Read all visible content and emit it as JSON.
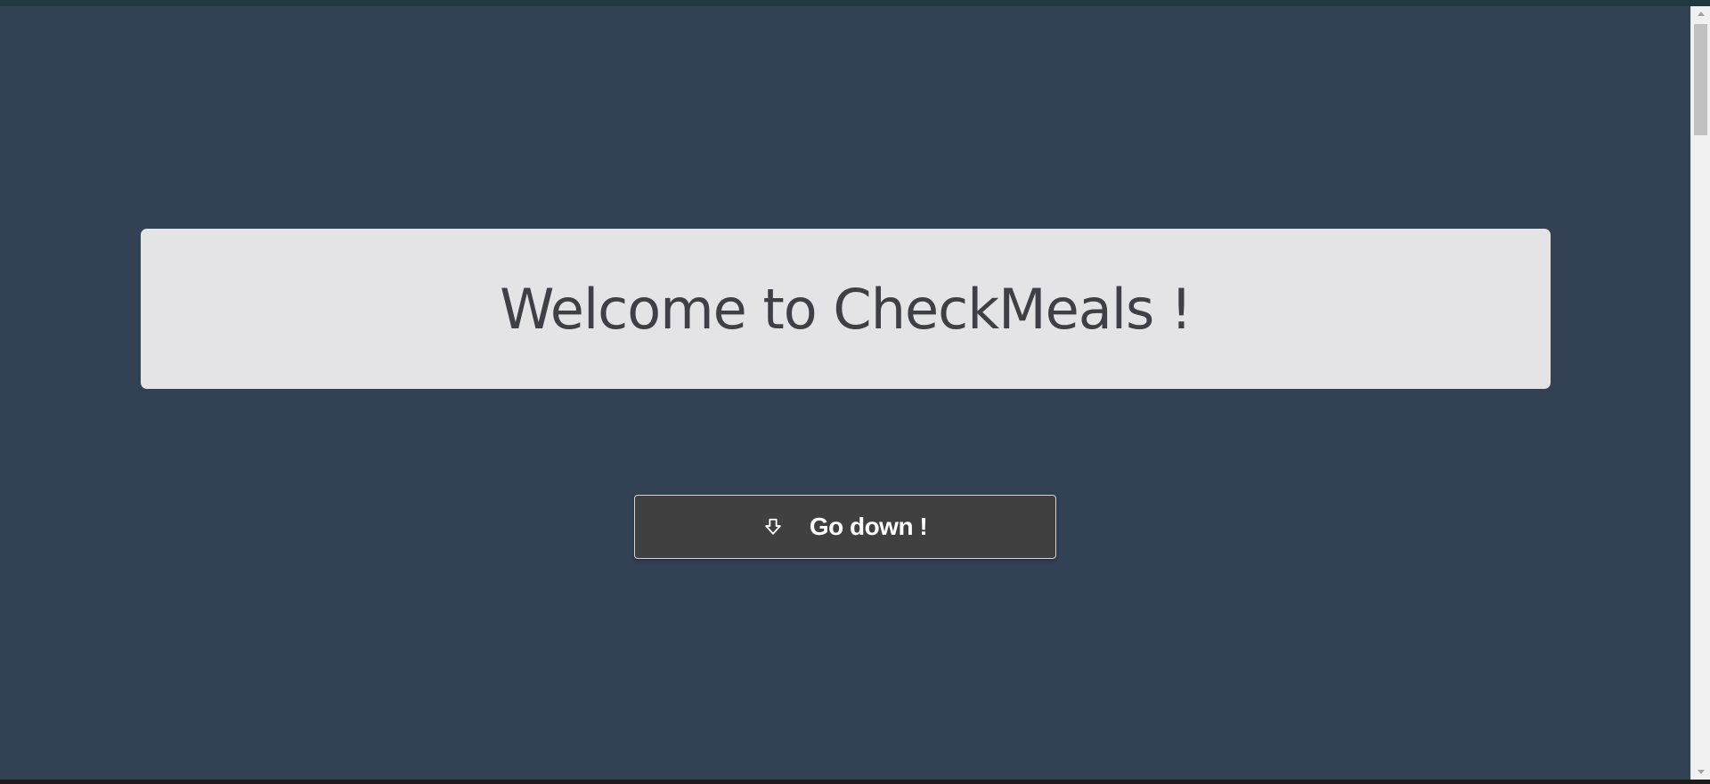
{
  "page": {
    "background_color": "#334155"
  },
  "banner": {
    "title": "Welcome to CheckMeals !",
    "background_color": "#e4e4e7",
    "text_color": "#3f3f46"
  },
  "go_down_button": {
    "label": "Go down !",
    "icon": "arrow-down-outline-icon",
    "background_color": "#404040",
    "text_color": "#ffffff"
  },
  "scrollbar": {
    "icons": [
      "scroll-up-arrow-icon",
      "scroll-down-arrow-icon"
    ]
  }
}
